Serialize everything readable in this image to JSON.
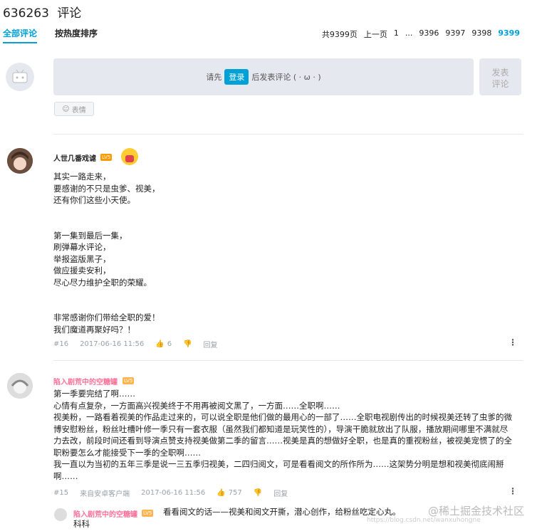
{
  "header": {
    "count": "636263",
    "title": "评论"
  },
  "tabs": [
    {
      "label": "全部评论"
    },
    {
      "label": "按热度排序"
    }
  ],
  "pager": {
    "total": "共9399页",
    "prev": "上一页",
    "p1": "1",
    "ellipsis": "...",
    "p2": "9396",
    "p3": "9397",
    "p4": "9398",
    "current": "9399"
  },
  "comment_box": {
    "prefix": "请先",
    "login": "登录",
    "suffix": "后发表评论 ( · ω · )",
    "post": "发表\n评论",
    "emoji": "表情"
  },
  "comments": [
    {
      "user": "人世几番戏谑",
      "level": "LV5",
      "text": "其实一路走来，\n要感谢的不只是虫爹、视美，\n还有你们这些小天使。\n\n\n第一集到最后一集，\n刷弹幕水评论，\n举报盗版黑子，\n做应援卖安利，\n尽心尽力维护全职的荣耀。\n\n\n非常感谢你们带给全职的爱！\n我们魔道再聚好吗？！",
      "floor": "#16",
      "time": "2017-06-16 11:56",
      "likes": "6",
      "reply": "回复"
    },
    {
      "user": "陷入剧荒中的空糖罐",
      "level": "LV5",
      "text": "第一季要完结了啊……\n心情有点复杂，一方面高兴视美终于不用再被阅文黑了，一方面……全职啊……\n视美粉，一路看着视美的作品走过来的，可以说全职是他们做的最用心的一部了……全职电视剧传出的时候视美还转了虫爹的微\n博安慰粉丝，粉丝吐槽叶修一季只有一套衣服（虽然我们都知道是玩笑性的），导演干脆就放出了队服，播放期间哪里不满就尽\n力去改，前段时间还看到导演点赞支持视美做第二季的留言……视美是真的想做好全职，也是真的重视粉丝，被视美宠惯了的全\n职粉要怎么才能接受下一季的全职啊……\n我一直以为当初的五年三季是说一三五季归视美，二四归阅文，可是看看阅文的所作所为……这架势分明是想和视美彻底闹掰\n啊……",
      "floor": "#15",
      "source": "来自安卓客户端",
      "time": "2017-06-16 11:56",
      "likes": "757",
      "reply": "回复"
    }
  ],
  "reply": {
    "user": "陷入剧荒中的空糖罐",
    "level": "LV5",
    "text": "看看阅文的话——视美和阅文开撕，潜心创作，给粉丝吃定心丸。",
    "text2": "科科"
  },
  "watermark": "@稀土掘金技术社区",
  "watermark_url": "https://blog.csdn.net/wanxuhongne"
}
